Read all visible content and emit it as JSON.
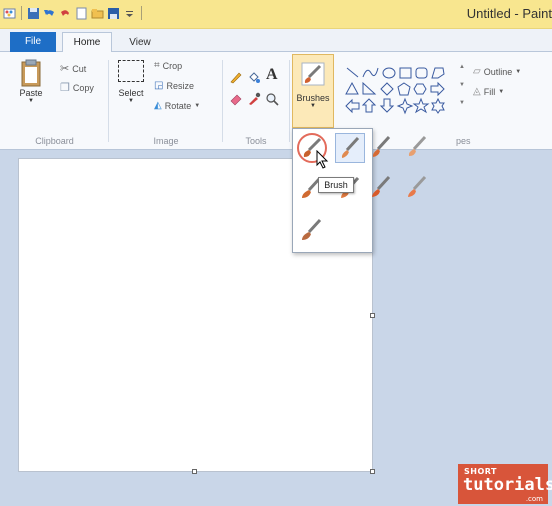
{
  "window": {
    "title": "Untitled - Paint"
  },
  "tabs": {
    "file": "File",
    "home": "Home",
    "view": "View"
  },
  "ribbon": {
    "clipboard": {
      "label": "Clipboard",
      "paste": "Paste",
      "cut": "Cut",
      "copy": "Copy"
    },
    "image": {
      "label": "Image",
      "select": "Select",
      "crop": "Crop",
      "resize": "Resize",
      "rotate": "Rotate"
    },
    "tools": {
      "label": "Tools"
    },
    "brushes": {
      "label": "Brushes"
    },
    "shapes": {
      "label": "Shapes",
      "label_partial": "pes",
      "outline": "Outline",
      "fill": "Fill"
    }
  },
  "dropdown": {
    "tooltip": "Brush",
    "brushes": [
      "brush",
      "calligraphy-brush-1",
      "calligraphy-brush-2",
      "airbrush",
      "oil-brush",
      "crayon",
      "marker",
      "natural-pencil",
      "watercolor-brush"
    ],
    "selected_index": 0
  },
  "watermark": {
    "top": "SHORT",
    "main": "tutorials",
    "suffix": ".com"
  },
  "colors": {
    "title_bar": "#f8e68f",
    "file_tab": "#1e6ec6",
    "ribbon_bg": "#f7f9fc",
    "workspace": "#c9d6e8",
    "watermark": "#d8553a"
  }
}
